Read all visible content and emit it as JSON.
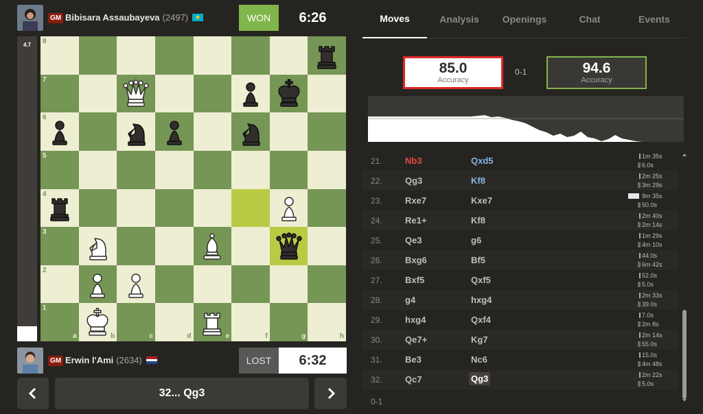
{
  "top_player": {
    "title": "GM",
    "name": "Bibisara Assaubayeva",
    "rating": "(2497)",
    "result": "WON",
    "clock": "6:26"
  },
  "bottom_player": {
    "title": "GM",
    "name": "Erwin l'Ami",
    "rating": "(2634)",
    "result": "LOST",
    "clock": "6:32"
  },
  "eval": {
    "value": "4.7",
    "white_fraction": 0.05
  },
  "board": {
    "files": [
      "a",
      "b",
      "c",
      "d",
      "e",
      "f",
      "g",
      "h"
    ],
    "ranks": [
      "8",
      "7",
      "6",
      "5",
      "4",
      "3",
      "2",
      "1"
    ],
    "position": [
      [
        "",
        "",
        "",
        "",
        "",
        "",
        "",
        "bR"
      ],
      [
        "",
        "",
        "wQ",
        "",
        "",
        "bP",
        "bK",
        ""
      ],
      [
        "bP",
        "",
        "bN",
        "bP",
        "",
        "bN",
        "",
        ""
      ],
      [
        "",
        "",
        "",
        "",
        "",
        "",
        "",
        ""
      ],
      [
        "bR",
        "",
        "",
        "",
        "",
        "",
        "wP",
        ""
      ],
      [
        "",
        "wN",
        "",
        "",
        "wB",
        "",
        "bQ",
        ""
      ],
      [
        "",
        "wP",
        "wP",
        "",
        "",
        "",
        "",
        ""
      ],
      [
        "",
        "wK",
        "",
        "",
        "wR",
        "",
        "",
        ""
      ]
    ],
    "highlights": [
      [
        4,
        5
      ],
      [
        5,
        6
      ]
    ]
  },
  "nav": {
    "current_move": "32... Qg3",
    "prev_icon": "chevron-left-icon",
    "next_icon": "chevron-right-icon"
  },
  "tabs": [
    "Moves",
    "Analysis",
    "Openings",
    "Chat",
    "Events"
  ],
  "accuracy": {
    "white": "85.0",
    "white_label": "Accuracy",
    "black": "94.6",
    "black_label": "Accuracy",
    "score": "0-1"
  },
  "moves": [
    {
      "n": "21.",
      "w": "Nb3",
      "w_class": "miss",
      "b": "Qxd5",
      "b_class": "best",
      "tw": "1m 35s",
      "tb": "6.0s"
    },
    {
      "n": "22.",
      "w": "Qg3",
      "w_class": "",
      "b": "Kf8",
      "b_class": "best",
      "tw": "2m 25s",
      "tb": "3m 29s"
    },
    {
      "n": "23.",
      "w": "Rxe7",
      "w_class": "",
      "b": "Kxe7",
      "b_class": "",
      "tw": "9m 35s",
      "tb": "50.0s"
    },
    {
      "n": "24.",
      "w": "Re1+",
      "w_class": "",
      "b": "Kf8",
      "b_class": "",
      "tw": "2m 40s",
      "tb": "2m 14s"
    },
    {
      "n": "25.",
      "w": "Qe3",
      "w_class": "",
      "b": "g6",
      "b_class": "",
      "tw": "1m 29s",
      "tb": "4m 10s"
    },
    {
      "n": "26.",
      "w": "Bxg6",
      "w_class": "",
      "b": "Bf5",
      "b_class": "",
      "tw": "44.0s",
      "tb": "6m 42s"
    },
    {
      "n": "27.",
      "w": "Bxf5",
      "w_class": "",
      "b": "Qxf5",
      "b_class": "",
      "tw": "52.0s",
      "tb": "5.0s"
    },
    {
      "n": "28.",
      "w": "g4",
      "w_class": "",
      "b": "hxg4",
      "b_class": "",
      "tw": "2m 33s",
      "tb": "39.0s"
    },
    {
      "n": "29.",
      "w": "hxg4",
      "w_class": "",
      "b": "Qxf4",
      "b_class": "",
      "tw": "7.0s",
      "tb": "2m 8s"
    },
    {
      "n": "30.",
      "w": "Qe7+",
      "w_class": "",
      "b": "Kg7",
      "b_class": "",
      "tw": "2m 14s",
      "tb": "55.0s"
    },
    {
      "n": "31.",
      "w": "Be3",
      "w_class": "",
      "b": "Nc6",
      "b_class": "",
      "tw": "15.0s",
      "tb": "4m 48s"
    },
    {
      "n": "32.",
      "w": "Qc7",
      "w_class": "",
      "b": "Qg3",
      "b_class": "cur",
      "tw": "2m 22s",
      "tb": "5.0s"
    }
  ],
  "final_score": "0-1",
  "colors": {
    "light": "#eeeed2",
    "dark": "#769656",
    "highlight": "#baca44",
    "won": "#81b64c",
    "miss": "#e64b43",
    "best": "#81b6e1"
  }
}
